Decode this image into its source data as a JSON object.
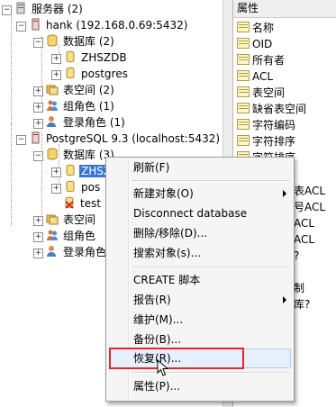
{
  "tree": {
    "servers": "服务器 (2)",
    "hank": "hank (192.168.0.69:5432)",
    "hank_db": "数据库 (2)",
    "zhszdb1": "ZHSZDB",
    "postgres1": "postgres",
    "tablespace1": "表空间 (2)",
    "grouproles1": "组角色 (1)",
    "loginroles1": "登录角色 (1)",
    "pg93": "PostgreSQL 9.3 (localhost:5432)",
    "pg93_db": "数据库 (3)",
    "zhszdb2": "ZHSZDB",
    "postgres2": "pos",
    "test": "test",
    "tablespace2": "表空间",
    "grouproles2": "组角色",
    "loginroles2": "登录角色"
  },
  "properties": {
    "header": "属性",
    "rows": [
      "名称",
      "OID",
      "所有者",
      "ACL",
      "表空间",
      "缺省表空间",
      "字符编码",
      "字符排序",
      "字符排序"
    ],
    "fragments": [
      "表ACL",
      "号ACL",
      "ACL",
      "ACL",
      "?",
      "制",
      "库?"
    ]
  },
  "context_menu": {
    "refresh": "刷新(F)",
    "new_object": "新建对象(O)",
    "disconnect": "Disconnect database",
    "delete": "删除/移除(D)...",
    "search": "搜索对象(s)...",
    "create_script": "CREATE 脚本",
    "report": "报告(R)",
    "maintain": "维护(M)...",
    "backup": "备份(B)...",
    "restore": "恢复(R)...",
    "properties": "属性(P)..."
  },
  "colors": {
    "selection": "#3875d7",
    "highlight_box": "#e2262a"
  }
}
